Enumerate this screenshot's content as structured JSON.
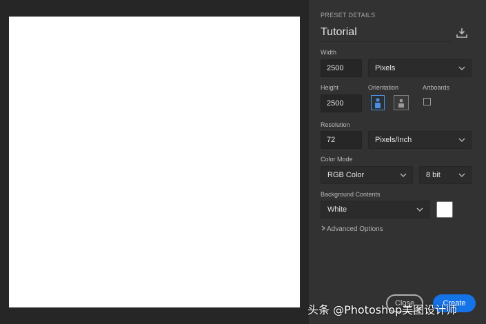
{
  "preset": {
    "section_title": "PRESET DETAILS",
    "name": "Tutorial",
    "save_icon": "save-preset-icon"
  },
  "width": {
    "label": "Width",
    "value": "2500",
    "unit": "Pixels"
  },
  "height": {
    "label": "Height",
    "value": "2500"
  },
  "orientation": {
    "label": "Orientation",
    "selected": "portrait"
  },
  "artboards": {
    "label": "Artboards",
    "checked": false
  },
  "resolution": {
    "label": "Resolution",
    "value": "72",
    "unit": "Pixels/Inch"
  },
  "color_mode": {
    "label": "Color Mode",
    "value": "RGB Color",
    "bit_depth": "8 bit"
  },
  "background": {
    "label": "Background Contents",
    "value": "White",
    "swatch_color": "#ffffff"
  },
  "advanced": {
    "label": "Advanced Options"
  },
  "buttons": {
    "close": "Close",
    "create": "Create"
  },
  "watermark": "头条 @Photoshop美图设计师",
  "colors": {
    "accent": "#1473e6",
    "panel": "#323232",
    "canvas": "#ffffff"
  }
}
